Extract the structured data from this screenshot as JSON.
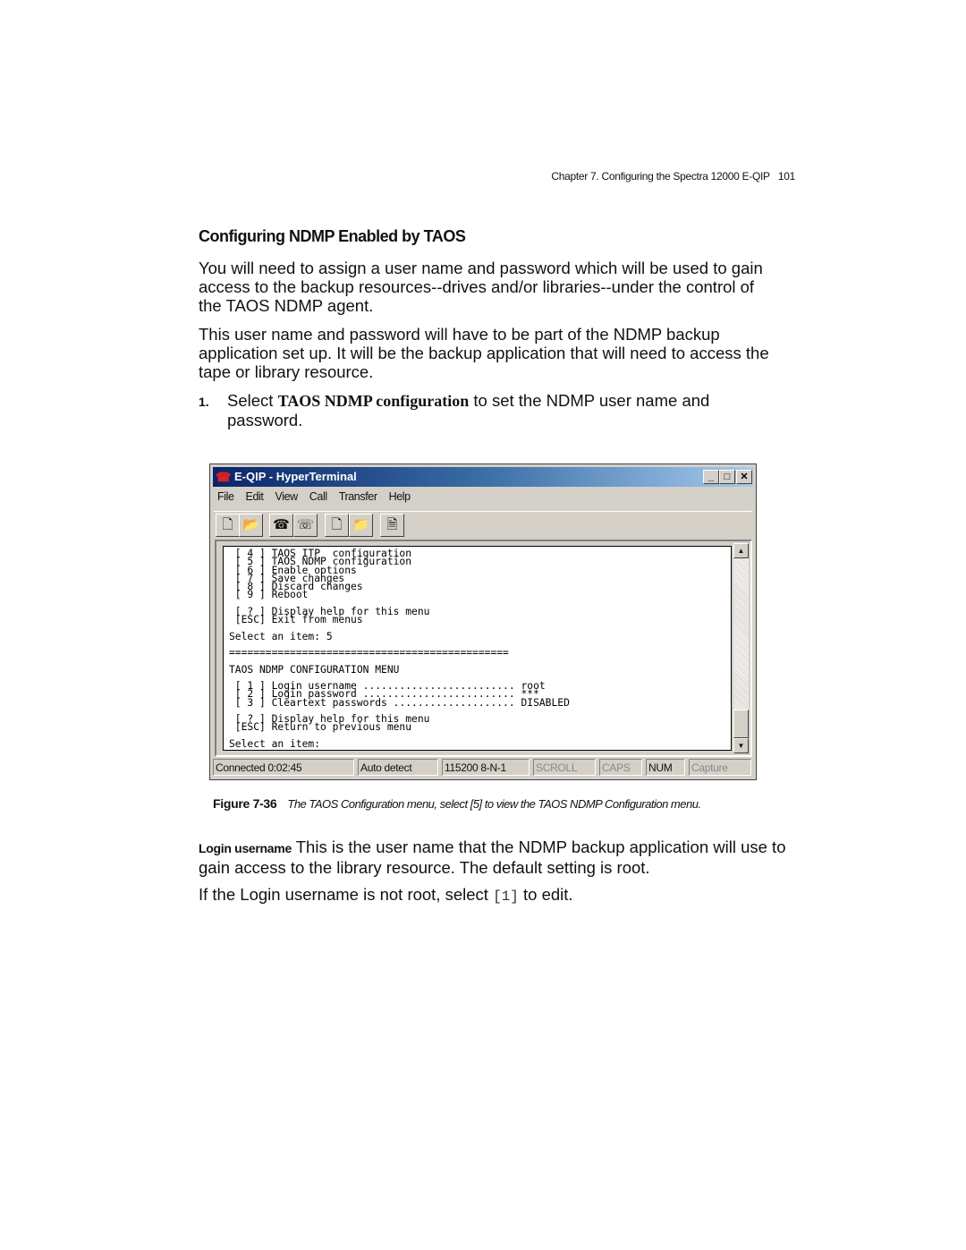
{
  "header": {
    "running_head": "Chapter 7. Configuring the Spectra 12000 E-QIP",
    "page_number": "101"
  },
  "heading": "Configuring NDMP Enabled by TAOS",
  "paragraphs": [
    "You will need to assign a user name and password which will be used to gain access to the backup resources--drives and/or libraries--under the control of the TAOS NDMP agent.",
    "This user name and password will have to be part of the NDMP backup application set up. It will be the backup application that will need to access the tape or library resource."
  ],
  "step": {
    "number": "1.",
    "pre": "Select ",
    "bold": "TAOS NDMP configuration",
    "post": " to set the NDMP user name and password."
  },
  "window": {
    "title": "E-QIP - HyperTerminal",
    "menu": [
      "File",
      "Edit",
      "View",
      "Call",
      "Transfer",
      "Help"
    ],
    "toolbar_icons": [
      "new-icon",
      "open-icon",
      "call-icon",
      "disconnect-icon",
      "send-icon",
      "receive-icon",
      "properties-icon"
    ],
    "terminal_lines": [
      " [ 4 ] TAOS ITP  configuration",
      " [ 5 ] TAOS NDMP configuration",
      " [ 6 ] Enable options",
      " [ 7 ] Save changes",
      " [ 8 ] Discard changes",
      " [ 9 ] Reboot",
      "",
      " [ ? ] Display help for this menu",
      " [ESC] Exit from menus",
      "",
      "Select an item: 5",
      "",
      "==============================================",
      "",
      "TAOS NDMP CONFIGURATION MENU",
      "",
      " [ 1 ] Login username ......................... root",
      " [ 2 ] Login password ......................... ***",
      " [ 3 ] Cleartext passwords .................... DISABLED",
      "",
      " [ ? ] Display help for this menu",
      " [ESC] Return to previous menu",
      "",
      "Select an item:"
    ],
    "status": {
      "connected": "Connected 0:02:45",
      "detect": "Auto detect",
      "port": "115200 8-N-1",
      "scroll": "SCROLL",
      "caps": "CAPS",
      "num": "NUM",
      "capture": "Capture"
    }
  },
  "caption": {
    "label": "Figure 7-36",
    "text": "The TAOS Configuration menu, select [5] to view the TAOS NDMP Configuration menu."
  },
  "login": {
    "term": "Login username",
    "text": " This is the user name that the NDMP backup application will use to gain access to the library resource. The default setting is root."
  },
  "last": {
    "pre": "If the Login username is not root, select ",
    "code": "[1]",
    "post": " to edit."
  }
}
